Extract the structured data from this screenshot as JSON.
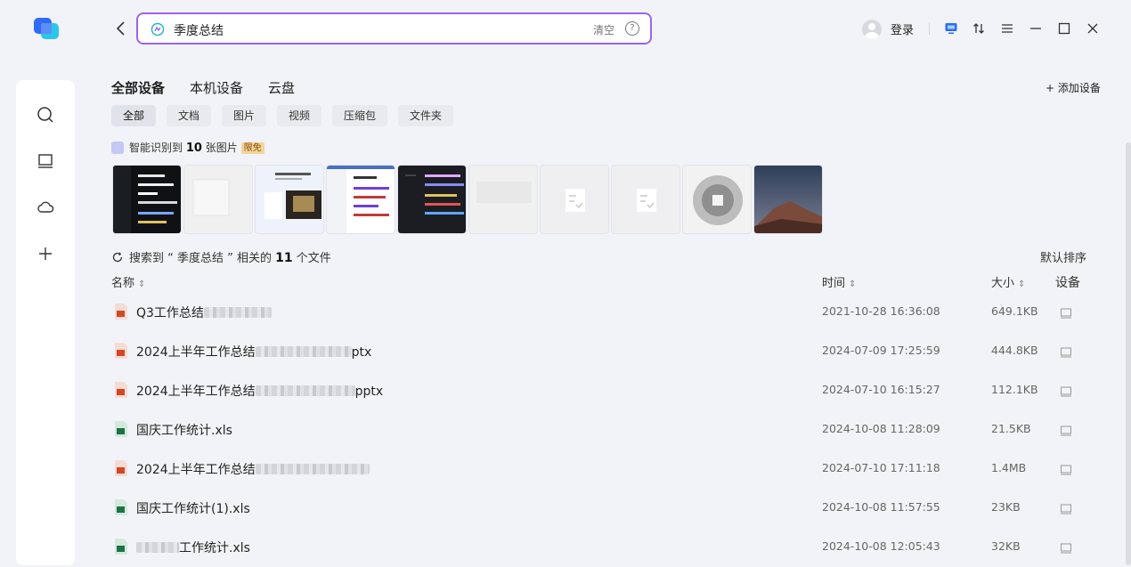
{
  "search": {
    "query": "季度总结",
    "clear_label": "清空",
    "help_label": "?"
  },
  "titlebar": {
    "login_label": "登录"
  },
  "tabs": [
    {
      "label": "全部设备",
      "active": true
    },
    {
      "label": "本机设备",
      "active": false
    },
    {
      "label": "云盘",
      "active": false
    }
  ],
  "add_device_label": "+ 添加设备",
  "filters": [
    {
      "label": "全部",
      "active": true
    },
    {
      "label": "文档",
      "active": false
    },
    {
      "label": "图片",
      "active": false
    },
    {
      "label": "视频",
      "active": false
    },
    {
      "label": "压缩包",
      "active": false
    },
    {
      "label": "文件夹",
      "active": false
    }
  ],
  "ai_images": {
    "prefix": "智能识别到",
    "count": "10",
    "suffix": "张图片",
    "badge": "限免"
  },
  "thumbnails": [
    {
      "icon": "code-screenshot-thumb"
    },
    {
      "icon": "blank-thumb"
    },
    {
      "icon": "app-promo-thumb"
    },
    {
      "icon": "code-light-thumb"
    },
    {
      "icon": "code-dark-thumb"
    },
    {
      "icon": "blank-thumb"
    },
    {
      "icon": "doc-check-thumb"
    },
    {
      "icon": "doc-check-thumb"
    },
    {
      "icon": "blurred-circle-thumb"
    },
    {
      "icon": "mountain-photo-thumb"
    }
  ],
  "result_summary": {
    "prefix": "搜索到 “ 季度总结 ” 相关的",
    "count": "11",
    "suffix": "个文件"
  },
  "sort_label": "默认排序",
  "columns": {
    "name": "名称",
    "time": "时间",
    "size": "大小",
    "device": "设备"
  },
  "files": [
    {
      "name": "Q3工作总结",
      "tail": "",
      "type": "ppt",
      "time": "2021-10-28 16:36:08",
      "size": "649.1KB"
    },
    {
      "name": "2024上半年工作总结",
      "tail": "ptx",
      "type": "ppt",
      "time": "2024-07-09 17:25:59",
      "size": "444.8KB"
    },
    {
      "name": "2024上半年工作总结",
      "tail": "pptx",
      "type": "ppt",
      "time": "2024-07-10 16:15:27",
      "size": "112.1KB"
    },
    {
      "name": "国庆工作统计.xls",
      "tail": "",
      "type": "xls",
      "time": "2024-10-08 11:28:09",
      "size": "21.5KB"
    },
    {
      "name": "2024上半年工作总结",
      "tail": "",
      "type": "ppt",
      "time": "2024-07-10 17:11:18",
      "size": "1.4MB"
    },
    {
      "name": "国庆工作统计(1).xls",
      "tail": "",
      "type": "xls",
      "time": "2024-10-08 11:57:55",
      "size": "23KB"
    },
    {
      "name": "工作统计.xls",
      "tail": "",
      "type": "xls",
      "time": "2024-10-08 12:05:43",
      "size": "32KB"
    }
  ],
  "colors": {
    "accent": "#9b63f2",
    "ppt": "#d24726",
    "xls": "#1e7145"
  }
}
